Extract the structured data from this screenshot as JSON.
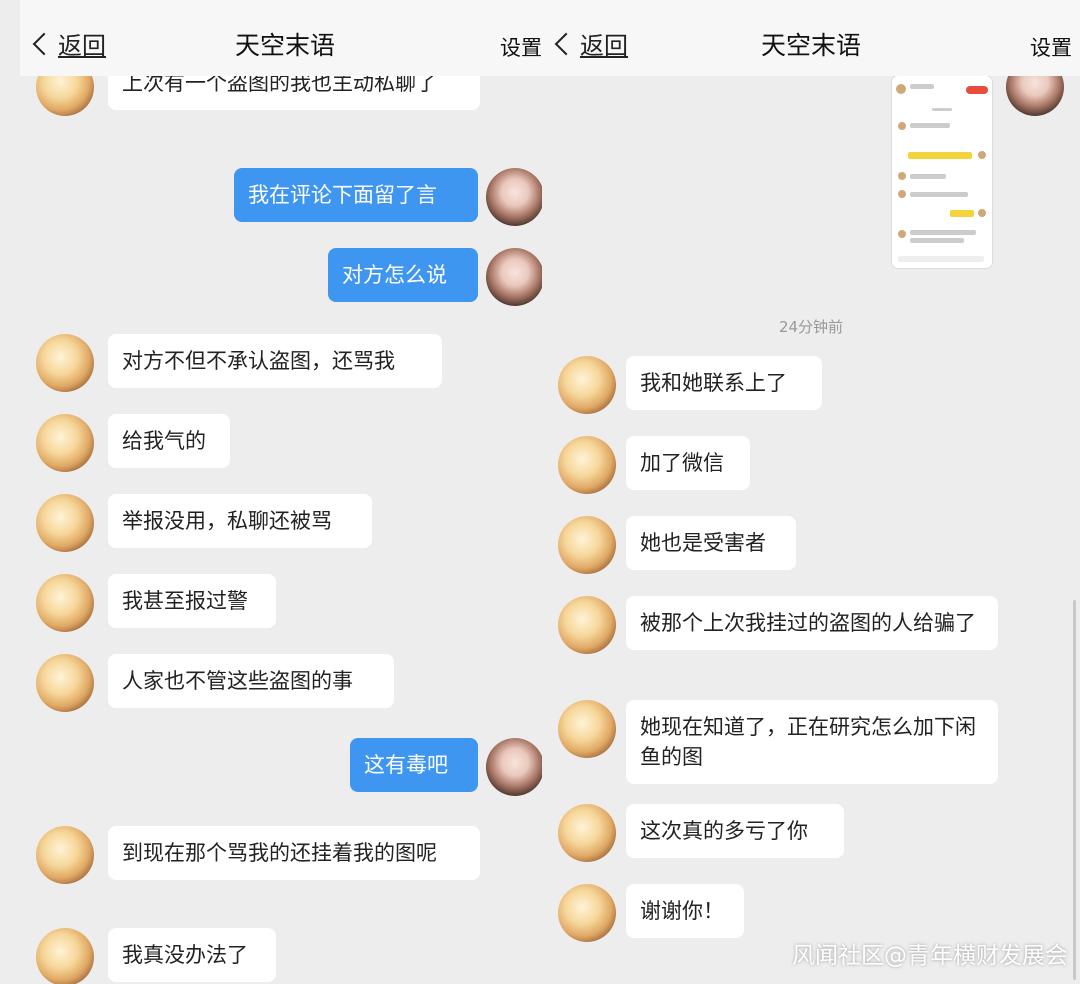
{
  "left": {
    "nav": {
      "back": "返回",
      "title": "天空末语",
      "settings": "设置"
    },
    "messages": [
      {
        "from": "other",
        "text": "上次有一个盗图的我也主动私聊了"
      },
      {
        "from": "me",
        "text": "我在评论下面留了言"
      },
      {
        "from": "me",
        "text": "对方怎么说"
      },
      {
        "from": "other",
        "text": "对方不但不承认盗图，还骂我"
      },
      {
        "from": "other",
        "text": "给我气的"
      },
      {
        "from": "other",
        "text": "举报没用，私聊还被骂"
      },
      {
        "from": "other",
        "text": "我甚至报过警"
      },
      {
        "from": "other",
        "text": "人家也不管这些盗图的事"
      },
      {
        "from": "me",
        "text": "这有毒吧"
      },
      {
        "from": "other",
        "text": "到现在那个骂我的还挂着我的图呢"
      },
      {
        "from": "other",
        "text": "我真没办法了"
      }
    ]
  },
  "right": {
    "nav": {
      "back": "返回",
      "title": "天空末语",
      "settings": "设置"
    },
    "timestamp": "24分钟前",
    "messages": [
      {
        "from": "other",
        "text": "我和她联系上了"
      },
      {
        "from": "other",
        "text": "加了微信"
      },
      {
        "from": "other",
        "text": "她也是受害者"
      },
      {
        "from": "other",
        "text": "被那个上次我挂过的盗图的人给骗了"
      },
      {
        "from": "other",
        "text": "她现在知道了，正在研究怎么加下闲鱼的图"
      },
      {
        "from": "other",
        "text": "这次真的多亏了你"
      },
      {
        "from": "other",
        "text": "谢谢你！"
      }
    ]
  },
  "watermark": "风闻社区@青年横财发展会",
  "colors": {
    "outgoing_bubble": "#3f96f0",
    "incoming_bubble": "#ffffff",
    "background": "#ededed"
  }
}
